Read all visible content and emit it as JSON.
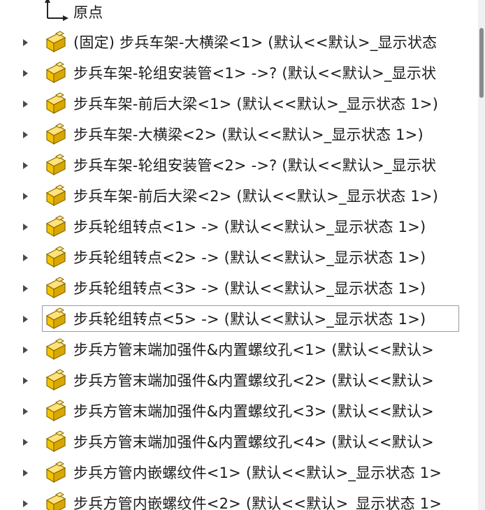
{
  "tree": {
    "origin_label": "原点",
    "items": [
      {
        "label": "(固定) 步兵车架-大横梁<1> (默认<<默认>_显示状态"
      },
      {
        "label": "步兵车架-轮组安装管<1> ->? (默认<<默认>_显示状"
      },
      {
        "label": "步兵车架-前后大梁<1> (默认<<默认>_显示状态 1>)"
      },
      {
        "label": "步兵车架-大横梁<2> (默认<<默认>_显示状态 1>)"
      },
      {
        "label": "步兵车架-轮组安装管<2> ->? (默认<<默认>_显示状"
      },
      {
        "label": "步兵车架-前后大梁<2> (默认<<默认>_显示状态 1>)"
      },
      {
        "label": "步兵轮组转点<1> -> (默认<<默认>_显示状态 1>)"
      },
      {
        "label": "步兵轮组转点<2> -> (默认<<默认>_显示状态 1>)"
      },
      {
        "label": "步兵轮组转点<3> -> (默认<<默认>_显示状态 1>)"
      },
      {
        "label": "步兵轮组转点<5> -> (默认<<默认>_显示状态 1>)"
      },
      {
        "label": "步兵方管末端加强件&内置螺纹孔<1> (默认<<默认>"
      },
      {
        "label": "步兵方管末端加强件&内置螺纹孔<2> (默认<<默认>"
      },
      {
        "label": "步兵方管末端加强件&内置螺纹孔<3> (默认<<默认>"
      },
      {
        "label": "步兵方管末端加强件&内置螺纹孔<4> (默认<<默认>"
      },
      {
        "label": "步兵方管内嵌螺纹件<1> (默认<<默认>_显示状态 1>"
      },
      {
        "label": "步兵方管内嵌螺纹件<2> (默认<<默认>_显示状态 1>"
      }
    ],
    "selected_item": "步兵轮组转点<5> -> (默认<<默认>_显示状态 1>)"
  },
  "colors": {
    "icon_fill": "#f2c200",
    "icon_stroke": "#8a6a00",
    "text": "#1c1c1c",
    "selection_border": "#9a9a9a"
  },
  "icons": {
    "part": "part-icon",
    "origin": "origin-icon",
    "expand": "expand-arrow-icon"
  }
}
